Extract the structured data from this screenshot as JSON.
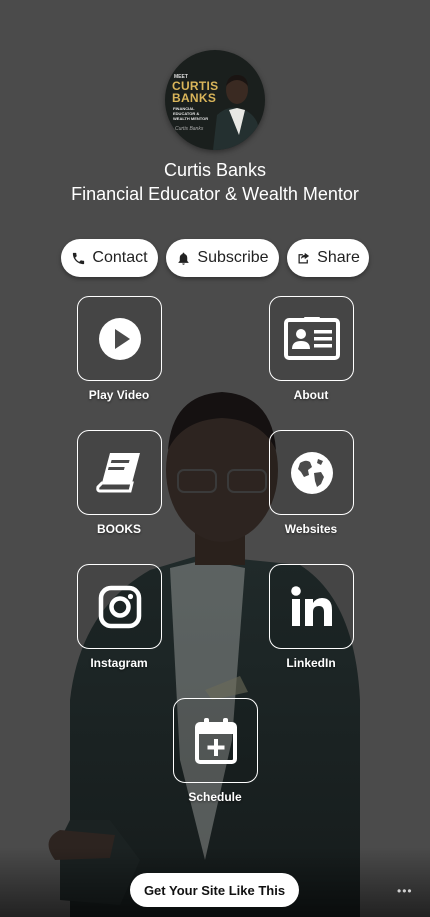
{
  "profile": {
    "name": "Curtis Banks",
    "role": "Financial Educator & Wealth Mentor",
    "avatar": {
      "meet": "MEET",
      "name_line1": "CURTIS",
      "name_line2": "BANKS",
      "tagline": "FINANCIAL EDUCATOR & WEALTH MENTOR",
      "signature": "Curtis Banks"
    }
  },
  "actions": {
    "contact": "Contact",
    "subscribe": "Subscribe",
    "share": "Share"
  },
  "tiles": {
    "play_video": "Play Video",
    "about": "About",
    "books": "BOOKS",
    "websites": "Websites",
    "instagram": "Instagram",
    "linkedin": "LinkedIn",
    "schedule": "Schedule"
  },
  "footer": {
    "cta": "Get Your Site Like This",
    "more": "•••"
  },
  "colors": {
    "background": "#4b4b4b",
    "accent_gold": "#d9b55a",
    "button_bg": "#ffffff"
  },
  "icons": [
    "phone-icon",
    "bell-icon",
    "share-icon",
    "play-icon",
    "contact-card-icon",
    "book-icon",
    "globe-icon",
    "instagram-icon",
    "linkedin-icon",
    "calendar-plus-icon"
  ]
}
